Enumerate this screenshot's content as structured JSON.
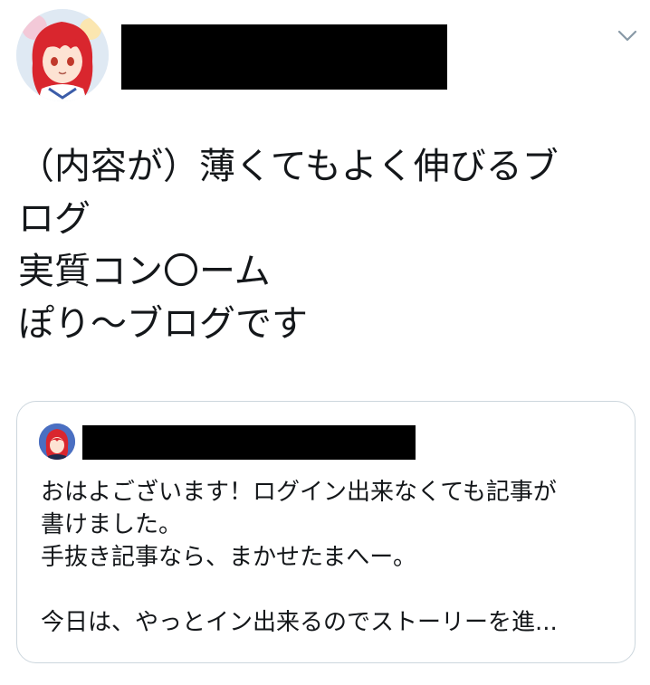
{
  "tweet": {
    "lines": [
      "（内容が）薄くてもよく伸びるブ",
      "ログ",
      "実質コン〇ーム",
      "ぽり～ブログです"
    ]
  },
  "quoted_tweet": {
    "lines": [
      "おはよございます！ログイン出来なくても記事が",
      "書けました。",
      "手抜き記事なら、まかせたまへー。",
      "",
      "今日は、やっとイン出来るのでストーリーを進..."
    ]
  },
  "icons": {
    "menu": "chevron-down-icon"
  },
  "colors": {
    "text": "#14171a",
    "border": "#ccd6dd",
    "chevron": "#8899a6",
    "redaction": "#000000"
  }
}
